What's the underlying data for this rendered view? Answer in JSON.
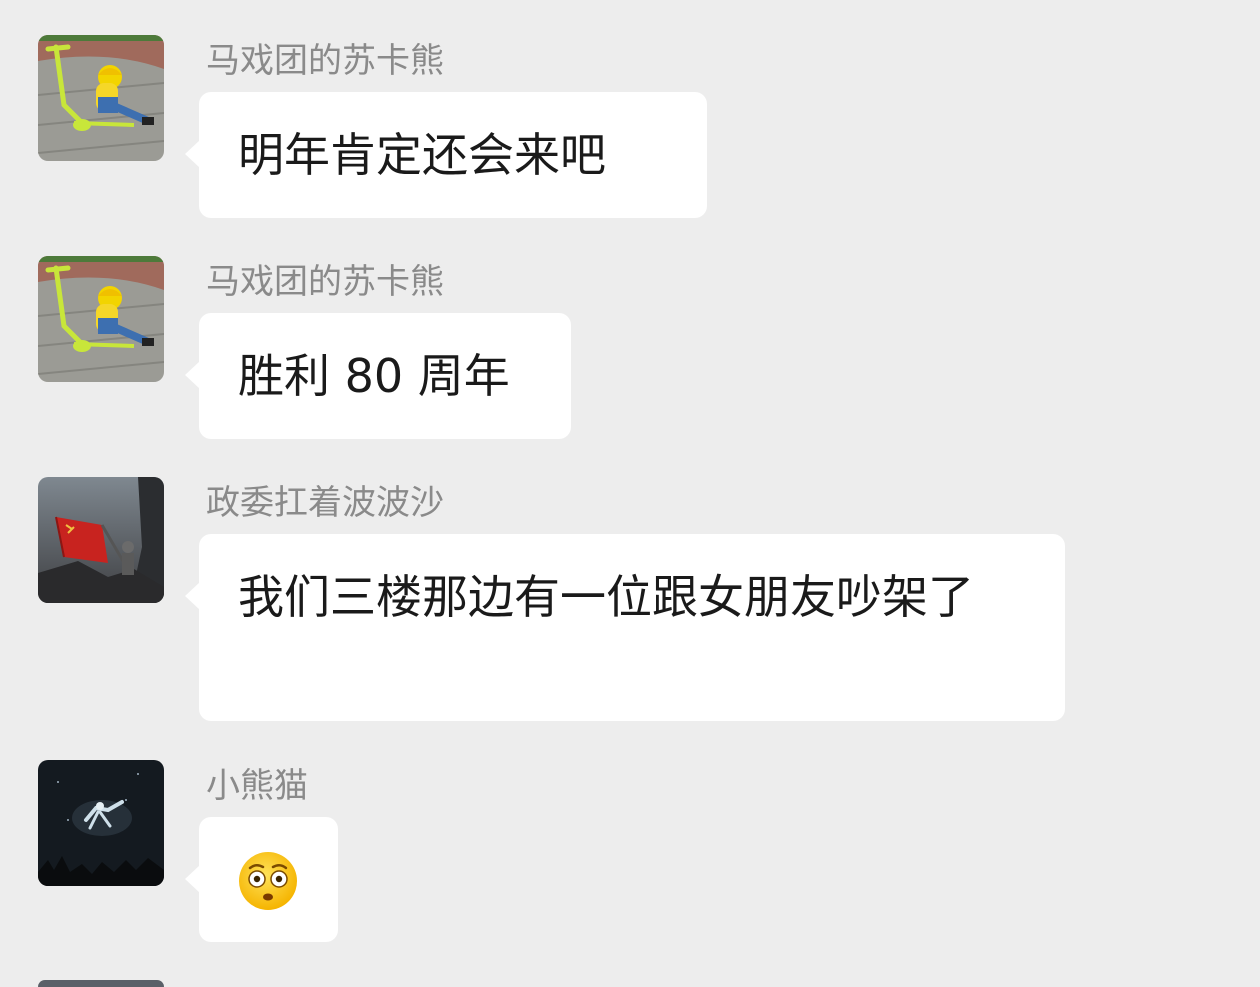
{
  "messages": [
    {
      "sender": "马戏团的苏卡熊",
      "text": "明年肯定还会来吧",
      "avatar_icon": "minion-scooter-avatar"
    },
    {
      "sender": "马戏团的苏卡熊",
      "text": "胜利 80 周年",
      "avatar_icon": "minion-scooter-avatar"
    },
    {
      "sender": "政委扛着波波沙",
      "text": "我们三楼那边有一位跟女朋友吵架了",
      "avatar_icon": "red-flag-avatar"
    },
    {
      "sender": "小熊猫",
      "text": "",
      "emoji": "wide-eyed-face-emoji",
      "avatar_icon": "night-sky-figure-avatar"
    }
  ],
  "colors": {
    "background": "#ededed",
    "bubble": "#ffffff",
    "sender_name": "#8a8a8a",
    "message_text": "#1a1a1a"
  }
}
